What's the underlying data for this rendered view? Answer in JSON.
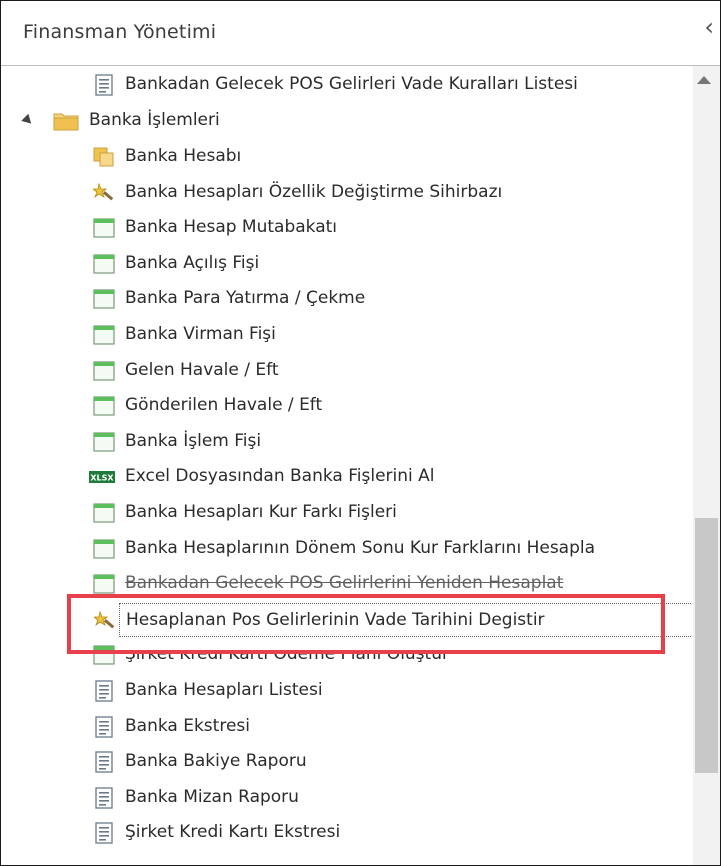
{
  "panel": {
    "title": "Finansman Yönetimi"
  },
  "tree": {
    "top_item": "Bankadan Gelecek POS Gelirleri Vade Kuralları Listesi",
    "folder": "Banka İşlemleri",
    "items": [
      {
        "label": "Banka Hesabı",
        "icon": "folder-doc-icon"
      },
      {
        "label": "Banka Hesapları Özellik Değiştirme Sihirbazı",
        "icon": "wizard-icon"
      },
      {
        "label": "Banka Hesap Mutabakatı",
        "icon": "form-icon"
      },
      {
        "label": "Banka Açılış Fişi",
        "icon": "form-icon"
      },
      {
        "label": "Banka Para Yatırma / Çekme",
        "icon": "form-icon"
      },
      {
        "label": "Banka Virman Fişi",
        "icon": "form-icon"
      },
      {
        "label": "Gelen Havale / Eft",
        "icon": "form-icon"
      },
      {
        "label": "Gönderilen Havale / Eft",
        "icon": "form-icon"
      },
      {
        "label": "Banka İşlem Fişi",
        "icon": "form-icon"
      },
      {
        "label": "Excel Dosyasından Banka Fişlerini Al",
        "icon": "xlsx-icon"
      },
      {
        "label": "Banka Hesapları Kur Farkı Fişleri",
        "icon": "form-icon"
      },
      {
        "label": "Banka Hesaplarının Dönem Sonu Kur Farklarını Hesapla",
        "icon": "form-icon"
      },
      {
        "label": "Bankadan Gelecek POS Gelirlerini Yeniden Hesaplat",
        "icon": "form-icon"
      },
      {
        "label": "Hesaplanan Pos Gelirlerinin Vade Tarihini Degistir",
        "icon": "wizard-icon"
      },
      {
        "label": "Şirket Kredi Kartı Ödeme Planı Oluştur",
        "icon": "form-icon"
      },
      {
        "label": "Banka Hesapları Listesi",
        "icon": "list-icon"
      },
      {
        "label": "Banka Ekstresi",
        "icon": "list-icon"
      },
      {
        "label": "Banka Bakiye Raporu",
        "icon": "list-icon"
      },
      {
        "label": "Banka Mizan Raporu",
        "icon": "list-icon"
      },
      {
        "label": "Şirket Kredi Kartı Ekstresi",
        "icon": "list-icon"
      }
    ]
  },
  "colors": {
    "highlight": "#e8404a",
    "form_green": "#5bbf5b",
    "folder_yellow": "#f0c050"
  }
}
